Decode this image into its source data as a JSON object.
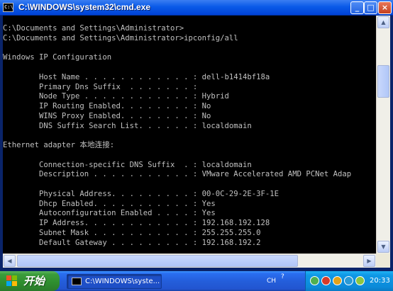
{
  "window": {
    "title": "C:\\WINDOWS\\system32\\cmd.exe",
    "icon": "console-icon",
    "controls": {
      "minimize": "_",
      "maximize": "□",
      "close": "×"
    }
  },
  "console": {
    "lines": [
      "C:\\Documents and Settings\\Administrator>",
      "C:\\Documents and Settings\\Administrator>ipconfig/all",
      "",
      "Windows IP Configuration",
      "",
      "        Host Name . . . . . . . . . . . . : dell-b1414bf18a",
      "        Primary Dns Suffix  . . . . . . . :",
      "        Node Type . . . . . . . . . . . . : Hybrid",
      "        IP Routing Enabled. . . . . . . . : No",
      "        WINS Proxy Enabled. . . . . . . . : No",
      "        DNS Suffix Search List. . . . . . : localdomain",
      "",
      "Ethernet adapter 本地连接:",
      "",
      "        Connection-specific DNS Suffix  . : localdomain",
      "        Description . . . . . . . . . . . : VMware Accelerated AMD PCNet Adap",
      "",
      "        Physical Address. . . . . . . . . : 00-0C-29-2E-3F-1E",
      "        Dhcp Enabled. . . . . . . . . . . : Yes",
      "        Autoconfiguration Enabled . . . . : Yes",
      "        IP Address. . . . . . . . . . . . : 192.168.192.128",
      "        Subnet Mask . . . . . . . . . . . : 255.255.255.0",
      "        Default Gateway . . . . . . . . . : 192.168.192.2"
    ]
  },
  "taskbar": {
    "start_label": "开始",
    "task_item_label": "C:\\WINDOWS\\syste...",
    "language": "CH",
    "clock": "20:33"
  },
  "colors": {
    "console_bg": "#000000",
    "console_text": "#c0c0c0",
    "title_bar": "#0a5ae8",
    "start_button": "#3c9d3c",
    "taskbar": "#245edb",
    "tray": "#0b8ad9"
  }
}
